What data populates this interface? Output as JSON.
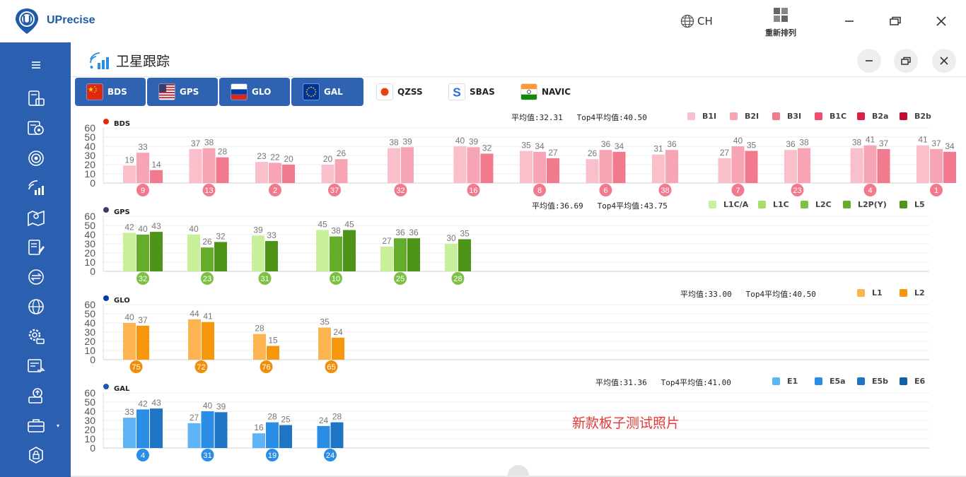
{
  "app": {
    "brand": "UPrecise",
    "lang": "CH",
    "rearrange_label": "重新排列"
  },
  "panel": {
    "title": "卫星跟踪"
  },
  "tabs": [
    {
      "label": "BDS",
      "active": true
    },
    {
      "label": "GPS",
      "active": true
    },
    {
      "label": "GLO",
      "active": true
    },
    {
      "label": "GAL",
      "active": true
    },
    {
      "label": "QZSS",
      "active": false
    },
    {
      "label": "SBAS",
      "active": false
    },
    {
      "label": "NAVIC",
      "active": false
    }
  ],
  "stats_labels": {
    "avg": "平均值:",
    "top4": "Top4平均值:"
  },
  "watermark": "新款板子测试照片",
  "chart_data": [
    {
      "name": "BDS",
      "type": "bar",
      "avg": "32.31",
      "top4": "40.50",
      "ylim": [
        0,
        60
      ],
      "yticks": [
        0,
        10,
        20,
        30,
        40,
        50,
        60
      ],
      "series": [
        {
          "name": "B1I",
          "color": "#f9c0cc"
        },
        {
          "name": "B2I",
          "color": "#f7a5b4"
        },
        {
          "name": "B3I",
          "color": "#f27a8f"
        },
        {
          "name": "B1C",
          "color": "#ec4e6d"
        },
        {
          "name": "B2a",
          "color": "#d82145"
        },
        {
          "name": "B2b",
          "color": "#c40830"
        }
      ],
      "badge_color": "#f27a8f",
      "satellites": [
        {
          "id": "9",
          "values": [
            19,
            33,
            14
          ]
        },
        {
          "id": "13",
          "values": [
            37,
            38,
            28
          ]
        },
        {
          "id": "2",
          "values": [
            23,
            22,
            20
          ]
        },
        {
          "id": "37",
          "values": [
            20,
            26
          ]
        },
        {
          "id": "32",
          "values": [
            38,
            39
          ]
        },
        {
          "id": "16",
          "values": [
            40,
            39,
            32
          ]
        },
        {
          "id": "8",
          "values": [
            35,
            34,
            27
          ]
        },
        {
          "id": "6",
          "values": [
            26,
            36,
            34
          ]
        },
        {
          "id": "38",
          "values": [
            31,
            36
          ]
        },
        {
          "id": "7",
          "values": [
            27,
            40,
            35
          ]
        },
        {
          "id": "23",
          "values": [
            36,
            38
          ]
        },
        {
          "id": "4",
          "values": [
            38,
            41,
            37
          ]
        },
        {
          "id": "1",
          "values": [
            41,
            37,
            34
          ]
        }
      ]
    },
    {
      "name": "GPS",
      "type": "bar",
      "avg": "36.69",
      "top4": "43.75",
      "ylim": [
        0,
        60
      ],
      "yticks": [
        0,
        10,
        20,
        30,
        40,
        50,
        60
      ],
      "series": [
        {
          "name": "L1C/A",
          "color": "#c8ef9a"
        },
        {
          "name": "L1C",
          "color": "#a6dd6b"
        },
        {
          "name": "L2C",
          "color": "#7cc242"
        },
        {
          "name": "L2P(Y)",
          "color": "#64ad2b"
        },
        {
          "name": "L5",
          "color": "#4d9418"
        }
      ],
      "badge_color": "#7cc242",
      "satellites": [
        {
          "id": "32",
          "values": [
            42,
            40,
            43
          ],
          "colors": [
            "#c8ef9a",
            "#64ad2b",
            "#4d9418"
          ]
        },
        {
          "id": "23",
          "values": [
            40,
            26,
            32
          ],
          "colors": [
            "#c8ef9a",
            "#64ad2b",
            "#4d9418"
          ]
        },
        {
          "id": "31",
          "values": [
            39,
            33
          ],
          "colors": [
            "#c8ef9a",
            "#4d9418"
          ]
        },
        {
          "id": "10",
          "values": [
            45,
            38,
            45
          ],
          "colors": [
            "#c8ef9a",
            "#64ad2b",
            "#4d9418"
          ]
        },
        {
          "id": "25",
          "values": [
            27,
            36,
            36
          ],
          "colors": [
            "#c8ef9a",
            "#64ad2b",
            "#4d9418"
          ]
        },
        {
          "id": "28",
          "values": [
            30,
            35
          ],
          "colors": [
            "#c8ef9a",
            "#4d9418"
          ]
        }
      ]
    },
    {
      "name": "GLO",
      "type": "bar",
      "avg": "33.00",
      "top4": "40.50",
      "ylim": [
        0,
        60
      ],
      "yticks": [
        0,
        10,
        20,
        30,
        40,
        50,
        60
      ],
      "series": [
        {
          "name": "L1",
          "color": "#fbb450"
        },
        {
          "name": "L2",
          "color": "#f7960a"
        }
      ],
      "badge_color": "#f0900a",
      "satellites": [
        {
          "id": "75",
          "values": [
            40,
            37
          ]
        },
        {
          "id": "72",
          "values": [
            44,
            41
          ]
        },
        {
          "id": "76",
          "values": [
            28,
            15
          ]
        },
        {
          "id": "65",
          "values": [
            35,
            24
          ]
        }
      ]
    },
    {
      "name": "GAL",
      "type": "bar",
      "avg": "31.36",
      "top4": "41.00",
      "ylim": [
        0,
        60
      ],
      "yticks": [
        0,
        10,
        20,
        30,
        40,
        50,
        60
      ],
      "series": [
        {
          "name": "E1",
          "color": "#5eb4f5"
        },
        {
          "name": "E5a",
          "color": "#2a8ee6"
        },
        {
          "name": "E5b",
          "color": "#1f74c4"
        },
        {
          "name": "E6",
          "color": "#145ea8"
        }
      ],
      "badge_color": "#2a8ee6",
      "satellites": [
        {
          "id": "4",
          "values": [
            33,
            42,
            43
          ]
        },
        {
          "id": "31",
          "values": [
            27,
            40,
            39
          ]
        },
        {
          "id": "19",
          "values": [
            16,
            28,
            25
          ]
        },
        {
          "id": "24",
          "values": [
            24,
            28
          ],
          "colors": [
            "#2a8ee6",
            "#1f74c4"
          ]
        }
      ]
    }
  ],
  "icons": {
    "sidebar": [
      "menu-icon",
      "device-icon",
      "location-search-icon",
      "target-icon",
      "satellite-signal-icon",
      "map-icon",
      "survey-edit-icon",
      "transfer-icon",
      "globe-icon",
      "settings-icon",
      "data-export-icon",
      "upload-icon",
      "tools-icon",
      "security-icon"
    ]
  }
}
